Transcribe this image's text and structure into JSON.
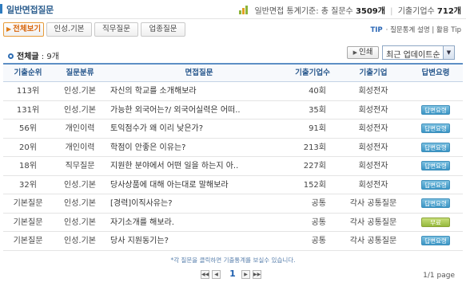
{
  "header": {
    "title": "일반면접질문",
    "stats_prefix": "일반면접 통계기준: 총 질문수",
    "total_questions": "3509개",
    "companies_prefix": "기출기업수",
    "total_companies": "712개",
    "separator": "|"
  },
  "tabs": [
    {
      "label": "전체보기",
      "active": true
    },
    {
      "label": "인성.기본",
      "active": false
    },
    {
      "label": "직무질문",
      "active": false
    },
    {
      "label": "업종질문",
      "active": false
    }
  ],
  "tip": {
    "label": "TIP",
    "text": "· 질문통계 설명 | 활용 Tip"
  },
  "list_info": {
    "total_label": "전체글",
    "total_count": ": 9개"
  },
  "toolbar": {
    "print_label": "인쇄",
    "sort_value": "최근 업데이트순"
  },
  "table": {
    "columns": [
      "기출순위",
      "질문분류",
      "면접질문",
      "기출기업수",
      "기출기업",
      "답변요령"
    ],
    "rows": [
      {
        "rank": "113위",
        "category": "인성.기본",
        "question": "자신의 학교를 소개해보라",
        "count": "40회",
        "company": "회성전자",
        "answer": ""
      },
      {
        "rank": "131위",
        "category": "인성.기본",
        "question": "가능한 외국어는?/ 외국어실력은 어떠..",
        "count": "35회",
        "company": "회성전자",
        "answer": "답변요령"
      },
      {
        "rank": "56위",
        "category": "개인이력",
        "question": "토익점수가 왜 이리 낮은가?",
        "count": "91회",
        "company": "회성전자",
        "answer": "답변요령"
      },
      {
        "rank": "20위",
        "category": "개인이력",
        "question": "학점이 안좋은 이유는?",
        "count": "213회",
        "company": "회성전자",
        "answer": "답변요령"
      },
      {
        "rank": "18위",
        "category": "직무질문",
        "question": "지원한 분야에서 어떤 일을 하는지 아..",
        "count": "227회",
        "company": "회성전자",
        "answer": "답변요령"
      },
      {
        "rank": "32위",
        "category": "인성.기본",
        "question": "당사상품에 대해 아는대로 말해보라",
        "count": "152회",
        "company": "회성전자",
        "answer": "답변요령"
      },
      {
        "rank": "기본질문",
        "category": "인성.기본",
        "question": "[경력]이직사유는?",
        "count": "공통",
        "company": "각사 공통질문",
        "answer": "답변요령"
      },
      {
        "rank": "기본질문",
        "category": "인성.기본",
        "question": "자기소개를 해보라.",
        "count": "공통",
        "company": "각사 공통질문",
        "answer": "무료"
      },
      {
        "rank": "기본질문",
        "category": "인성.기본",
        "question": "당사 지원동기는?",
        "count": "공통",
        "company": "각사 공통질문",
        "answer": "답변요령"
      }
    ]
  },
  "footer": {
    "note": "*각 질문을 클릭하면 기출통계를 보실수 있습니다.",
    "current_page": "1",
    "page_info": "1/1 page"
  },
  "colors": {
    "accent": "#2e6db3",
    "tab_active": "#e07a16",
    "answer_button": "#3a95c5",
    "free_button": "#95b83c"
  }
}
